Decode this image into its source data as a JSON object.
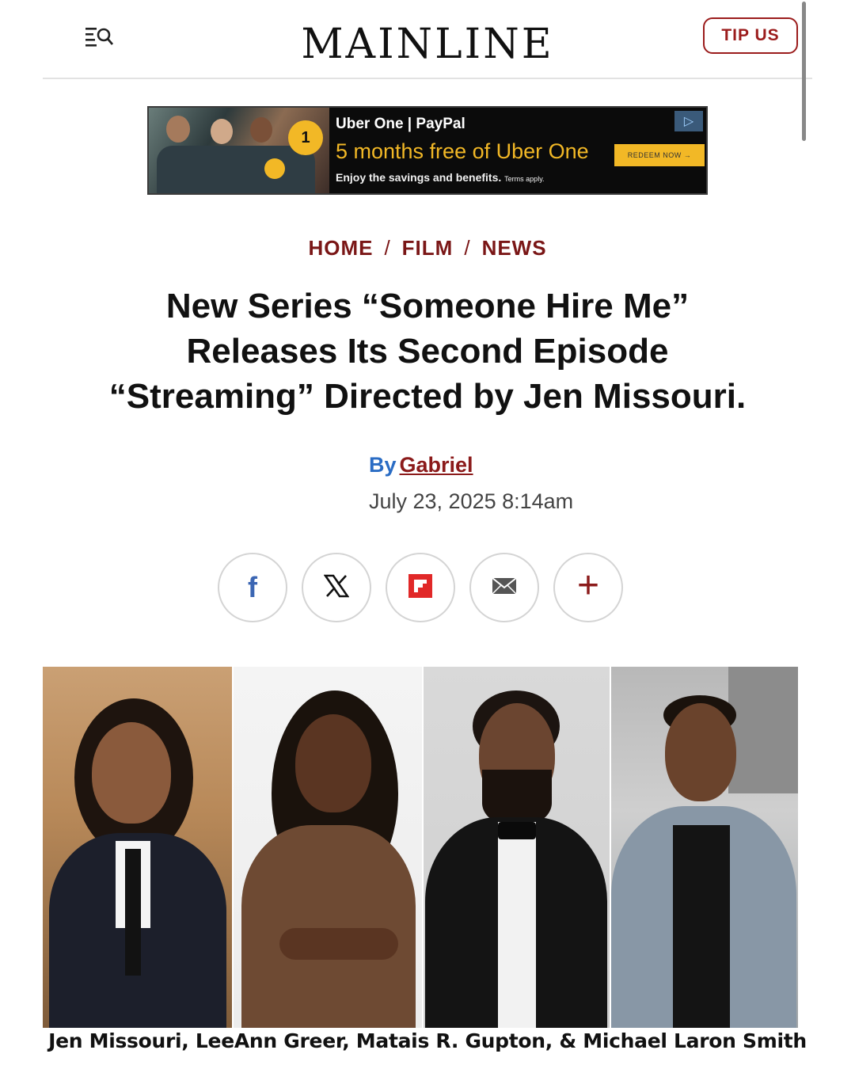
{
  "header": {
    "logo": "MAINLINE",
    "tip_label": "TIP US"
  },
  "ad": {
    "brands": "Uber One | PayPal",
    "headline": "5 months free of Uber One",
    "subtext": "Enjoy the savings and benefits.",
    "terms": "Terms apply.",
    "cta": "REDEEM NOW →"
  },
  "breadcrumb": [
    "HOME",
    "FILM",
    "NEWS"
  ],
  "article": {
    "title_lines": [
      "New Series “Someone Hire Me”",
      "Releases Its Second Episode",
      "“Streaming” Directed by Jen Missouri."
    ],
    "by_label": "By",
    "author": "Gabriel",
    "date": "July 23, 2025 8:14am"
  },
  "share_icons": [
    "facebook-icon",
    "x-icon",
    "flipboard-icon",
    "email-icon",
    "plus-icon"
  ],
  "colors": {
    "accent": "#8b1a1a",
    "byline_blue": "#2a6cc4",
    "ad_yellow": "#f2b826"
  },
  "photo_caption": "Jen Missouri, LeeAnn Greer, Matais R. Gupton, & Michael Laron Smith"
}
